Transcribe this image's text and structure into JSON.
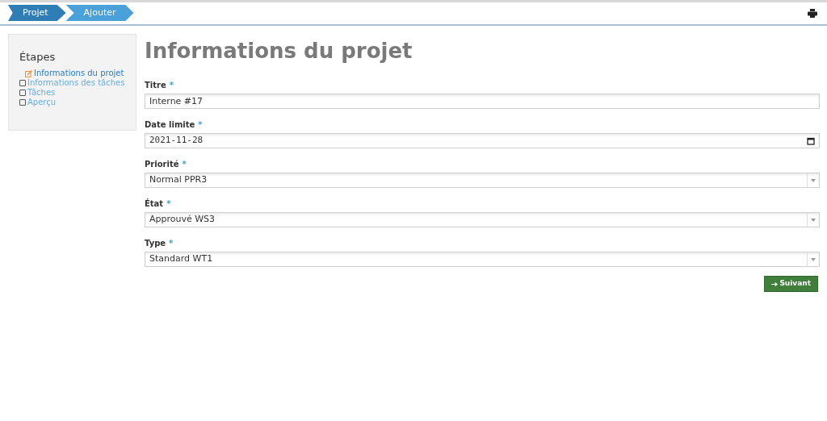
{
  "breadcrumb": [
    {
      "label": "Projet"
    },
    {
      "label": "Ajouter"
    }
  ],
  "sidebar": {
    "title": "Étapes",
    "steps": [
      {
        "label": "Informations du projet",
        "kind": "edit",
        "selected": true
      },
      {
        "label": "Informations des tâches",
        "kind": "checkbox",
        "selected": false
      },
      {
        "label": "Tâches",
        "kind": "checkbox",
        "selected": false
      },
      {
        "label": "Aperçu",
        "kind": "checkbox",
        "selected": false
      }
    ]
  },
  "heading": "Informations du projet",
  "fields": [
    {
      "label": "Titre",
      "required_mark": "*",
      "kind": "text",
      "value": "Interne #17"
    },
    {
      "label": "Date limite",
      "required_mark": "*",
      "kind": "date",
      "value": "2021-11-28"
    },
    {
      "label": "Priorité",
      "required_mark": "*",
      "kind": "select",
      "value": "Normal PPR3"
    },
    {
      "label": "État",
      "required_mark": "*",
      "kind": "select",
      "value": "Approuvé WS3"
    },
    {
      "label": "Type",
      "required_mark": "*",
      "kind": "select",
      "value": "Standard WT1"
    }
  ],
  "next_button": {
    "label": "Suivant"
  }
}
